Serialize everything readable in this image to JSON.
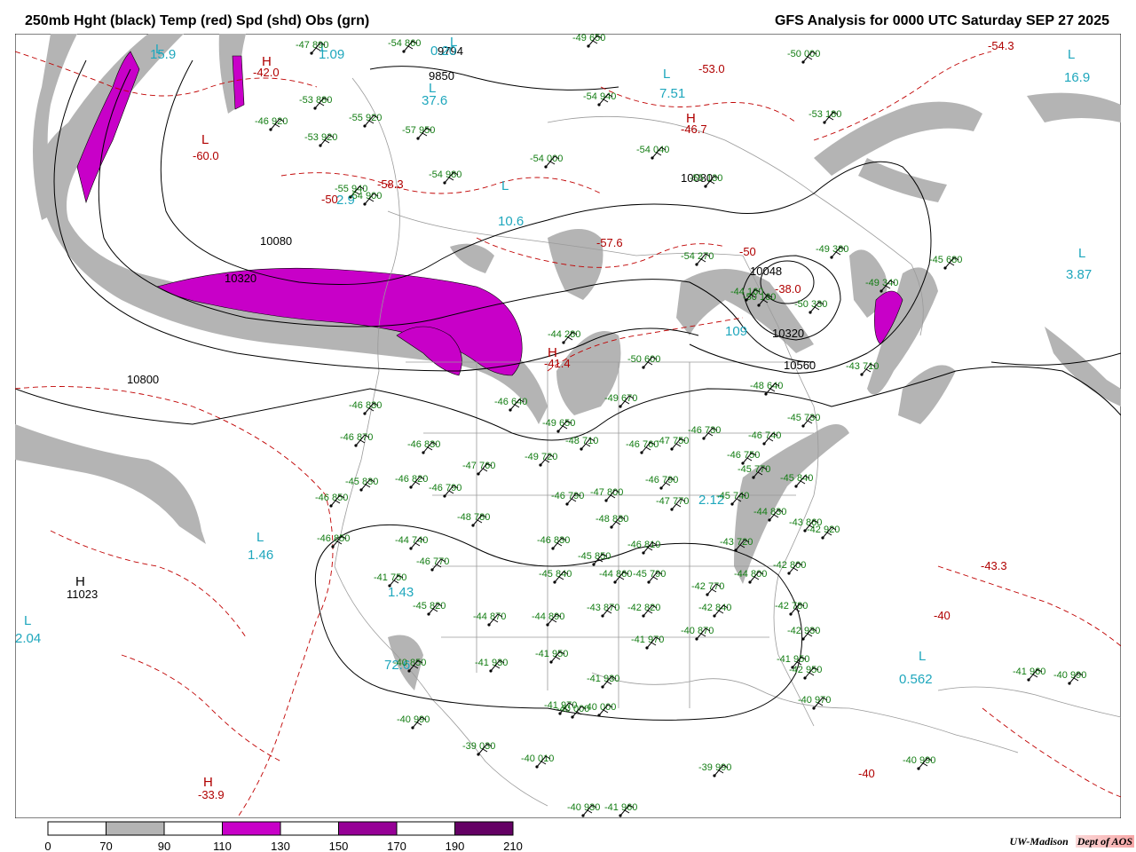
{
  "header": {
    "title": "250mb Hght (black) Temp (red) Spd (shd) Obs (grn)",
    "analysis": "GFS Analysis for 0000 UTC Saturday  SEP 27 2025"
  },
  "legend": {
    "ticks": [
      "0",
      "70",
      "90",
      "110",
      "130",
      "150",
      "170",
      "190",
      "210"
    ],
    "colors": [
      "#ffffff",
      "#b4b4b4",
      "#ffffff",
      "#c800c8",
      "#ffffff",
      "#960096",
      "#ffffff",
      "#640064"
    ]
  },
  "credit": {
    "org": "UW-Madison",
    "dept": "Dept of AOS"
  },
  "height_labels": [
    "9794",
    "9850",
    "10080",
    "10320",
    "10800",
    "10560",
    "10320",
    "10048",
    "10080",
    "11023"
  ],
  "pressure_centers": [
    {
      "letter": "L",
      "value": "15.9"
    },
    {
      "letter": "L",
      "value": "1.09"
    },
    {
      "letter": "L",
      "value": "0.20"
    },
    {
      "letter": "L",
      "value": "37.6"
    },
    {
      "letter": "L",
      "value": "7.51"
    },
    {
      "letter": "L",
      "value": "16.9"
    },
    {
      "letter": "L",
      "value": "10.6"
    },
    {
      "letter": "L",
      "value": "3.87"
    },
    {
      "letter": "L",
      "value": "2.9"
    },
    {
      "letter": "L",
      "value": "109"
    },
    {
      "letter": "L",
      "value": "1.46"
    },
    {
      "letter": "L",
      "value": "2.04"
    },
    {
      "letter": "L",
      "value": "1.43"
    },
    {
      "letter": "L",
      "value": "0.562"
    },
    {
      "letter": "L",
      "value": "72.6"
    },
    {
      "letter": "L",
      "value": "2.12"
    },
    {
      "letter": "H",
      "value": "11023"
    },
    {
      "letter": "H",
      "value": "-42.0"
    },
    {
      "letter": "H",
      "value": "-46.7"
    },
    {
      "letter": "H",
      "value": "-41.4"
    },
    {
      "letter": "H",
      "value": "-33.9"
    },
    {
      "letter": "L",
      "value": "-60.0"
    }
  ],
  "temp_labels": [
    "-58.3",
    "-57.6",
    "-54.3",
    "-38.0",
    "-43.3",
    "-40",
    "-40",
    "-50",
    "-53.0",
    "-50"
  ],
  "station_obs": [
    {
      "t": "-47",
      "h": "890"
    },
    {
      "t": "-54",
      "h": "860"
    },
    {
      "t": "-49",
      "h": "650"
    },
    {
      "t": "-53",
      "h": "880"
    },
    {
      "t": "-55",
      "h": "920"
    },
    {
      "t": "-46",
      "h": "920"
    },
    {
      "t": "-53",
      "h": "920"
    },
    {
      "t": "-57",
      "h": "950"
    },
    {
      "t": "-54",
      "h": "940"
    },
    {
      "t": "-50",
      "h": "000"
    },
    {
      "t": "-54",
      "h": "000"
    },
    {
      "t": "-54",
      "h": "980"
    },
    {
      "t": "-53",
      "h": "180"
    },
    {
      "t": "-54",
      "h": "040"
    },
    {
      "t": "-55",
      "h": "130"
    },
    {
      "t": "-55",
      "h": "940"
    },
    {
      "t": "-54",
      "h": "900"
    },
    {
      "t": "-49",
      "h": "380"
    },
    {
      "t": "-54",
      "h": "270"
    },
    {
      "t": "-50",
      "h": "160"
    },
    {
      "t": "-44",
      "h": "160"
    },
    {
      "t": "-50",
      "h": "330"
    },
    {
      "t": "-49",
      "h": "340"
    },
    {
      "t": "-45",
      "h": "680"
    },
    {
      "t": "-44",
      "h": "280"
    },
    {
      "t": "-50",
      "h": "600"
    },
    {
      "t": "-48",
      "h": "640"
    },
    {
      "t": "-43",
      "h": "710"
    },
    {
      "t": "-45",
      "h": "730"
    },
    {
      "t": "-46",
      "h": "740"
    },
    {
      "t": "-49",
      "h": "670"
    },
    {
      "t": "-46",
      "h": "640"
    },
    {
      "t": "-49",
      "h": "650"
    },
    {
      "t": "-48",
      "h": "710"
    },
    {
      "t": "-46",
      "h": "760"
    },
    {
      "t": "-47",
      "h": "750"
    },
    {
      "t": "-46",
      "h": "730"
    },
    {
      "t": "-46",
      "h": "750"
    },
    {
      "t": "-45",
      "h": "770"
    },
    {
      "t": "-45",
      "h": "840"
    },
    {
      "t": "-46",
      "h": "830"
    },
    {
      "t": "-46",
      "h": "870"
    },
    {
      "t": "-46",
      "h": "830"
    },
    {
      "t": "-47",
      "h": "760"
    },
    {
      "t": "-49",
      "h": "720"
    },
    {
      "t": "-45",
      "h": "830"
    },
    {
      "t": "-46",
      "h": "820"
    },
    {
      "t": "-46",
      "h": "790"
    },
    {
      "t": "-46",
      "h": "790"
    },
    {
      "t": "-47",
      "h": "800"
    },
    {
      "t": "-46",
      "h": "790"
    },
    {
      "t": "-47",
      "h": "770"
    },
    {
      "t": "-45",
      "h": "740"
    },
    {
      "t": "-46",
      "h": "850"
    },
    {
      "t": "-48",
      "h": "780"
    },
    {
      "t": "-48",
      "h": "830"
    },
    {
      "t": "-46",
      "h": "810"
    },
    {
      "t": "-44",
      "h": "830"
    },
    {
      "t": "-43",
      "h": "860"
    },
    {
      "t": "-42",
      "h": "920"
    },
    {
      "t": "-46",
      "h": "850"
    },
    {
      "t": "-44",
      "h": "740"
    },
    {
      "t": "-46",
      "h": "770"
    },
    {
      "t": "-46",
      "h": "830"
    },
    {
      "t": "-45",
      "h": "850"
    },
    {
      "t": "-43",
      "h": "720"
    },
    {
      "t": "-42",
      "h": "800"
    },
    {
      "t": "-41",
      "h": "750"
    },
    {
      "t": "-45",
      "h": "820"
    },
    {
      "t": "-45",
      "h": "840"
    },
    {
      "t": "-44",
      "h": "860"
    },
    {
      "t": "-45",
      "h": "790"
    },
    {
      "t": "-42",
      "h": "770"
    },
    {
      "t": "-44",
      "h": "800"
    },
    {
      "t": "-42",
      "h": "820"
    },
    {
      "t": "-44",
      "h": "870"
    },
    {
      "t": "-44",
      "h": "890"
    },
    {
      "t": "-43",
      "h": "870"
    },
    {
      "t": "-42",
      "h": "840"
    },
    {
      "t": "-42",
      "h": "780"
    },
    {
      "t": "-42",
      "h": "930"
    },
    {
      "t": "-41",
      "h": "970"
    },
    {
      "t": "-40",
      "h": "870"
    },
    {
      "t": "-40",
      "h": "850"
    },
    {
      "t": "-41",
      "h": "930"
    },
    {
      "t": "-41",
      "h": "950"
    },
    {
      "t": "-41",
      "h": "930"
    },
    {
      "t": "-41",
      "h": "950"
    },
    {
      "t": "-42",
      "h": "950"
    },
    {
      "t": "-41",
      "h": "960"
    },
    {
      "t": "-40",
      "h": "970"
    },
    {
      "t": "-41",
      "h": "970"
    },
    {
      "t": "-40",
      "h": "000"
    },
    {
      "t": "-40",
      "h": "000"
    },
    {
      "t": "-40",
      "h": "990"
    },
    {
      "t": "-39",
      "h": "030"
    },
    {
      "t": "-40",
      "h": "010"
    },
    {
      "t": "-39",
      "h": "990"
    },
    {
      "t": "-40",
      "h": "990"
    },
    {
      "t": "-40",
      "h": "990"
    },
    {
      "t": "-40",
      "h": "930"
    },
    {
      "t": "-41",
      "h": "960"
    }
  ]
}
